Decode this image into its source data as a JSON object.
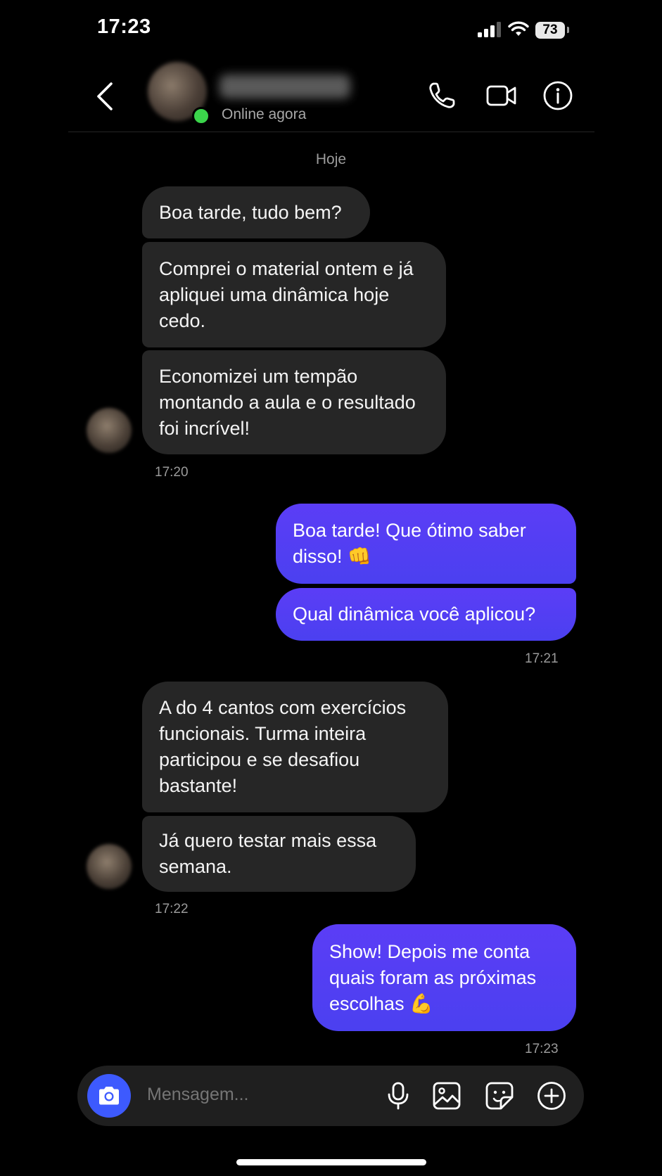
{
  "status_bar": {
    "time": "17:23",
    "battery": "73",
    "icons": [
      "signal-icon",
      "wifi-icon",
      "battery-icon"
    ]
  },
  "header": {
    "contact_status": "Online agora",
    "icons": [
      "back-chevron-icon",
      "phone-icon",
      "video-icon",
      "info-icon"
    ]
  },
  "conversation": {
    "day_label": "Hoje",
    "messages": [
      {
        "from": "them",
        "text": "Boa tarde, tudo bem?"
      },
      {
        "from": "them",
        "text": "Comprei o material ontem e já apliquei uma dinâmica hoje cedo."
      },
      {
        "from": "them",
        "text": "Economizei um tempão montando a aula e o resultado foi incrível!"
      },
      {
        "from": "me",
        "text": "Boa tarde! Que ótimo saber disso! 👊"
      },
      {
        "from": "me",
        "text": "Qual dinâmica você aplicou?"
      },
      {
        "from": "them",
        "text": "A do 4 cantos com exercícios funcionais. Turma inteira participou e se desafiou bastante!"
      },
      {
        "from": "them",
        "text": "Já quero testar mais essa semana."
      },
      {
        "from": "me",
        "text": "Show! Depois me conta quais foram as próximas escolhas 💪"
      }
    ],
    "timestamps": [
      "17:20",
      "17:21",
      "17:22",
      "17:23"
    ]
  },
  "composer": {
    "placeholder": "Mensagem...",
    "icons": [
      "camera-icon",
      "microphone-icon",
      "gallery-icon",
      "sticker-icon",
      "plus-icon"
    ]
  },
  "colors": {
    "background": "#000000",
    "incoming_bubble": "#262626",
    "outgoing_bubble": "#5140f3",
    "camera_button": "#3d5afe",
    "online_dot": "#3bd54b"
  }
}
